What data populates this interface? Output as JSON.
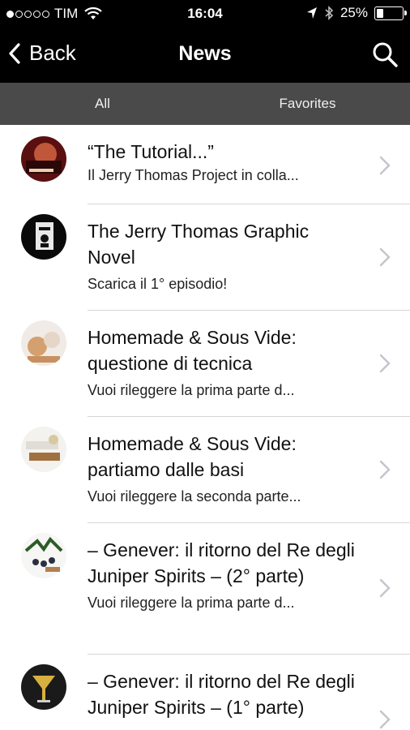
{
  "status_bar": {
    "carrier": "TIM",
    "time": "16:04",
    "battery": "25%",
    "battery_level": 0.25
  },
  "nav": {
    "back_label": "Back",
    "title": "News",
    "search_icon": "search-icon"
  },
  "tabs": [
    {
      "label": "All"
    },
    {
      "label": "Favorites"
    }
  ],
  "items": [
    {
      "title": "“The Tutorial...”",
      "subtitle": "Il Jerry Thomas Project in colla..."
    },
    {
      "title": "The Jerry Thomas Graphic Novel",
      "subtitle": "Scarica il 1° episodio!"
    },
    {
      "title": "Homemade & Sous Vide: questione di tecnica",
      "subtitle": "Vuoi rileggere la prima parte d..."
    },
    {
      "title": "Homemade & Sous Vide: partiamo dalle basi",
      "subtitle": "Vuoi rileggere la seconda parte..."
    },
    {
      "title": "– Genever: il ritorno del Re degli Juniper Spirits – (2° parte)",
      "subtitle": "Vuoi rileggere la prima parte d..."
    },
    {
      "title": "– Genever: il ritorno del Re degli Juniper Spirits – (1° parte)",
      "subtitle": ""
    }
  ]
}
